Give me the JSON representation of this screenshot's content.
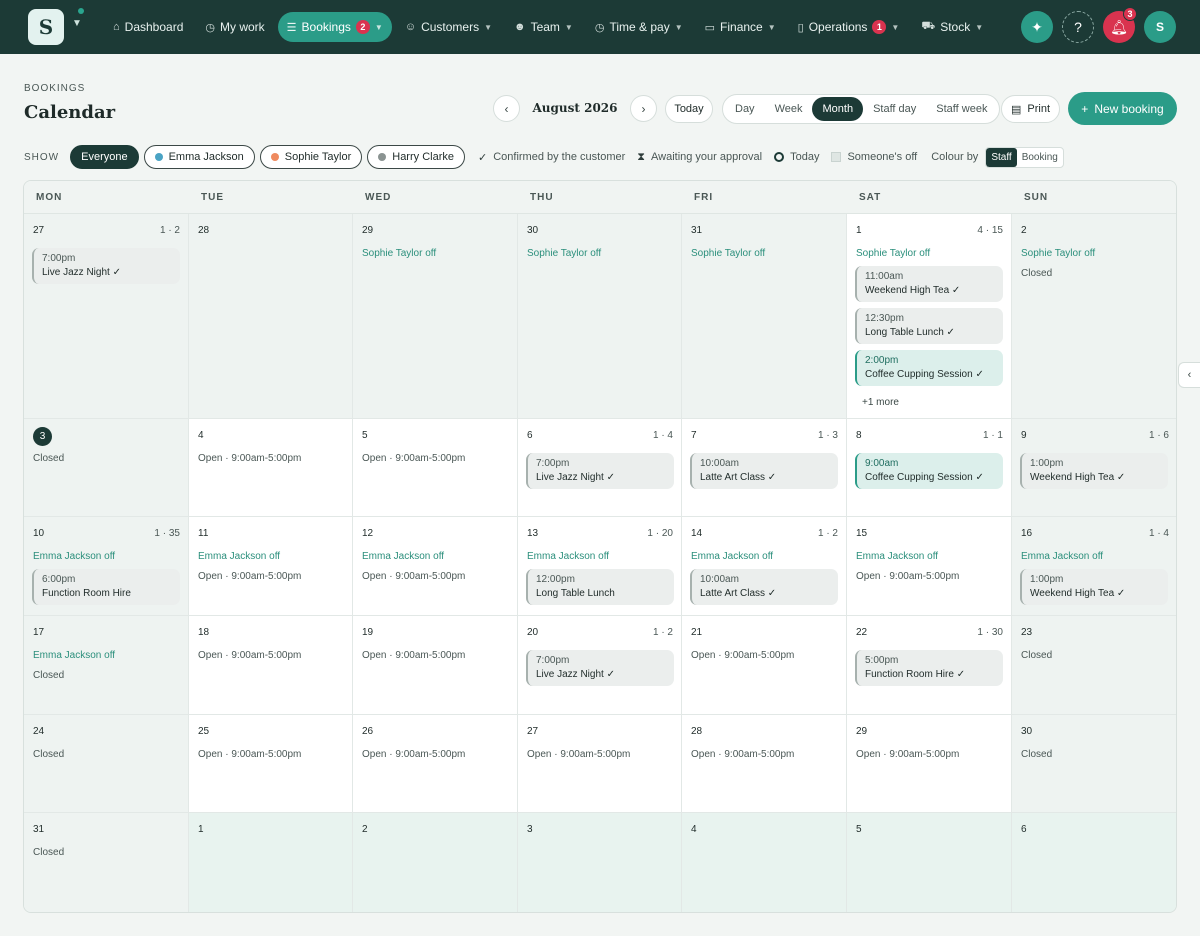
{
  "nav": {
    "logo": "S",
    "items": [
      {
        "label": "Dashboard",
        "icon": "home-icon"
      },
      {
        "label": "My work",
        "icon": "clock-icon"
      },
      {
        "label": "Bookings",
        "icon": "list-icon",
        "badge": "2",
        "active": true
      },
      {
        "label": "Customers",
        "icon": "users-icon"
      },
      {
        "label": "Team",
        "icon": "team-icon"
      },
      {
        "label": "Time & pay",
        "icon": "clock-icon"
      },
      {
        "label": "Finance",
        "icon": "card-icon"
      },
      {
        "label": "Operations",
        "icon": "clipboard-icon",
        "badge": "1"
      },
      {
        "label": "Stock",
        "icon": "cart-icon"
      }
    ],
    "notifications": "3",
    "avatar": "S"
  },
  "header": {
    "breadcrumb": "BOOKINGS",
    "title": "Calendar",
    "month": "August 2026",
    "today_label": "Today",
    "views": [
      "Day",
      "Week",
      "Month",
      "Staff day",
      "Staff week"
    ],
    "active_view": "Month",
    "print_label": "Print",
    "new_booking_label": "New booking"
  },
  "filters": {
    "show_label": "SHOW",
    "chips": [
      {
        "label": "Everyone",
        "active": true
      },
      {
        "label": "Emma Jackson",
        "color": "#4aa3c4"
      },
      {
        "label": "Sophie Taylor",
        "color": "#ef8a5f"
      },
      {
        "label": "Harry Clarke",
        "color": "#8a9391"
      }
    ],
    "legend": [
      "Confirmed by the customer",
      "Awaiting your approval",
      "Today",
      "Someone's off"
    ],
    "colour_by_label": "Colour by",
    "colour_options": [
      "Staff",
      "Booking"
    ],
    "colour_active": "Staff"
  },
  "calendar": {
    "weekdays": [
      "MON",
      "TUE",
      "WED",
      "THU",
      "FRI",
      "SAT",
      "SUN"
    ],
    "weeks": [
      [
        {
          "day": "27",
          "type": "other",
          "count": "1 · 2",
          "events": [
            {
              "time": "7:00pm",
              "name": "Live Jazz Night ✓"
            }
          ]
        },
        {
          "day": "28",
          "type": "other"
        },
        {
          "day": "29",
          "type": "other",
          "lines": [
            {
              "text": "Sophie Taylor off",
              "off": true
            }
          ]
        },
        {
          "day": "30",
          "type": "other",
          "lines": [
            {
              "text": "Sophie Taylor off",
              "off": true
            }
          ]
        },
        {
          "day": "31",
          "type": "other",
          "lines": [
            {
              "text": "Sophie Taylor off",
              "off": true
            }
          ]
        },
        {
          "day": "1",
          "type": "cur",
          "count": "4 · 15",
          "lines": [
            {
              "text": "Sophie Taylor off",
              "off": true
            }
          ],
          "events": [
            {
              "time": "11:00am",
              "name": "Weekend High Tea ✓"
            },
            {
              "time": "12:30pm",
              "name": "Long Table Lunch ✓"
            },
            {
              "time": "2:00pm",
              "name": "Coffee Cupping Session ✓",
              "teal": true
            }
          ],
          "more": "+1 more"
        },
        {
          "day": "2",
          "type": "cur-sun",
          "lines": [
            {
              "text": "Sophie Taylor off",
              "off": true
            },
            {
              "text": "Closed"
            }
          ]
        }
      ],
      [
        {
          "day": "3",
          "type": "other",
          "today": true,
          "lines": [
            {
              "text": "Closed"
            }
          ]
        },
        {
          "day": "4",
          "type": "cur",
          "lines": [
            {
              "text": "Open · 9:00am-5:00pm"
            }
          ]
        },
        {
          "day": "5",
          "type": "cur",
          "lines": [
            {
              "text": "Open · 9:00am-5:00pm"
            }
          ]
        },
        {
          "day": "6",
          "type": "cur",
          "count": "1 · 4",
          "events": [
            {
              "time": "7:00pm",
              "name": "Live Jazz Night ✓"
            }
          ]
        },
        {
          "day": "7",
          "type": "cur",
          "count": "1 · 3",
          "events": [
            {
              "time": "10:00am",
              "name": "Latte Art Class ✓"
            }
          ]
        },
        {
          "day": "8",
          "type": "cur",
          "count": "1 · 1",
          "events": [
            {
              "time": "9:00am",
              "name": "Coffee Cupping Session ✓",
              "teal": true
            }
          ]
        },
        {
          "day": "9",
          "type": "other",
          "count": "1 · 6",
          "events": [
            {
              "time": "1:00pm",
              "name": "Weekend High Tea ✓"
            }
          ]
        }
      ],
      [
        {
          "day": "10",
          "type": "other",
          "count": "1 · 35",
          "lines": [
            {
              "text": "Emma Jackson off",
              "off": true
            }
          ],
          "events": [
            {
              "time": "6:00pm",
              "name": "Function Room Hire"
            }
          ]
        },
        {
          "day": "11",
          "type": "cur",
          "lines": [
            {
              "text": "Emma Jackson off",
              "off": true
            },
            {
              "text": "Open · 9:00am-5:00pm"
            }
          ]
        },
        {
          "day": "12",
          "type": "cur",
          "lines": [
            {
              "text": "Emma Jackson off",
              "off": true
            },
            {
              "text": "Open · 9:00am-5:00pm"
            }
          ]
        },
        {
          "day": "13",
          "type": "cur",
          "count": "1 · 20",
          "lines": [
            {
              "text": "Emma Jackson off",
              "off": true
            }
          ],
          "events": [
            {
              "time": "12:00pm",
              "name": "Long Table Lunch"
            }
          ]
        },
        {
          "day": "14",
          "type": "cur",
          "count": "1 · 2",
          "lines": [
            {
              "text": "Emma Jackson off",
              "off": true
            }
          ],
          "events": [
            {
              "time": "10:00am",
              "name": "Latte Art Class ✓"
            }
          ]
        },
        {
          "day": "15",
          "type": "cur",
          "lines": [
            {
              "text": "Emma Jackson off",
              "off": true
            },
            {
              "text": "Open · 9:00am-5:00pm"
            }
          ]
        },
        {
          "day": "16",
          "type": "other",
          "count": "1 · 4",
          "lines": [
            {
              "text": "Emma Jackson off",
              "off": true
            }
          ],
          "events": [
            {
              "time": "1:00pm",
              "name": "Weekend High Tea ✓"
            }
          ]
        }
      ],
      [
        {
          "day": "17",
          "type": "other",
          "lines": [
            {
              "text": "Emma Jackson off",
              "off": true
            },
            {
              "text": "Closed"
            }
          ]
        },
        {
          "day": "18",
          "type": "cur",
          "lines": [
            {
              "text": "Open · 9:00am-5:00pm"
            }
          ]
        },
        {
          "day": "19",
          "type": "cur",
          "lines": [
            {
              "text": "Open · 9:00am-5:00pm"
            }
          ]
        },
        {
          "day": "20",
          "type": "cur",
          "count": "1 · 2",
          "events": [
            {
              "time": "7:00pm",
              "name": "Live Jazz Night ✓"
            }
          ]
        },
        {
          "day": "21",
          "type": "cur",
          "lines": [
            {
              "text": "Open · 9:00am-5:00pm"
            }
          ]
        },
        {
          "day": "22",
          "type": "cur",
          "count": "1 · 30",
          "events": [
            {
              "time": "5:00pm",
              "name": "Function Room Hire ✓"
            }
          ]
        },
        {
          "day": "23",
          "type": "other",
          "lines": [
            {
              "text": "Closed"
            }
          ]
        }
      ],
      [
        {
          "day": "24",
          "type": "other",
          "lines": [
            {
              "text": "Closed"
            }
          ]
        },
        {
          "day": "25",
          "type": "cur",
          "lines": [
            {
              "text": "Open · 9:00am-5:00pm"
            }
          ]
        },
        {
          "day": "26",
          "type": "cur",
          "lines": [
            {
              "text": "Open · 9:00am-5:00pm"
            }
          ]
        },
        {
          "day": "27",
          "type": "cur",
          "lines": [
            {
              "text": "Open · 9:00am-5:00pm"
            }
          ]
        },
        {
          "day": "28",
          "type": "cur",
          "lines": [
            {
              "text": "Open · 9:00am-5:00pm"
            }
          ]
        },
        {
          "day": "29",
          "type": "cur",
          "lines": [
            {
              "text": "Open · 9:00am-5:00pm"
            }
          ]
        },
        {
          "day": "30",
          "type": "other",
          "lines": [
            {
              "text": "Closed"
            }
          ]
        }
      ],
      [
        {
          "day": "31",
          "type": "other",
          "lines": [
            {
              "text": "Closed"
            }
          ]
        },
        {
          "day": "1",
          "type": "next"
        },
        {
          "day": "2",
          "type": "next"
        },
        {
          "day": "3",
          "type": "next"
        },
        {
          "day": "4",
          "type": "next"
        },
        {
          "day": "5",
          "type": "next"
        },
        {
          "day": "6",
          "type": "next"
        }
      ]
    ]
  },
  "colors": {
    "nav_bg": "#1c3a36",
    "accent": "#2b9c88",
    "badge": "#d9334f",
    "off_text": "#2b8f7c"
  }
}
